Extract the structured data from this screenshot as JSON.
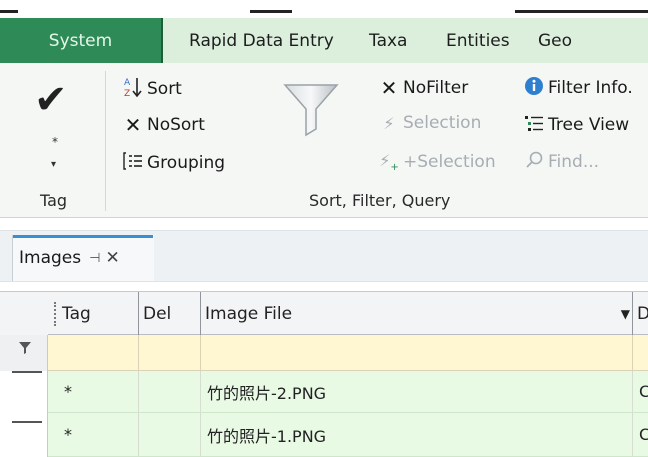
{
  "ribbon_tabs": {
    "system": "System",
    "rapid": "Rapid Data Entry",
    "taxa": "Taxa",
    "entities": "Entities",
    "geo": "Geo"
  },
  "tag_group": {
    "check_icon": "checkmark-icon",
    "star_text": "*",
    "label": "Tag"
  },
  "sort_group": {
    "sort_label": "Sort",
    "nosort_label": "NoSort",
    "grouping_label": "Grouping",
    "nofilter_label": "NoFilter",
    "selection_label": "Selection",
    "plus_selection_label": "+Selection",
    "filter_info_label": "Filter Info.",
    "tree_view_label": "Tree View",
    "find_label": "Find...",
    "group_label": "Sort, Filter, Query"
  },
  "doc_tab": {
    "title": "Images",
    "pin_glyph": "⊣",
    "close_glyph": "✕"
  },
  "grid": {
    "columns": [
      "Tag",
      "Del",
      "Image File",
      "D"
    ],
    "rows": [
      {
        "tag": "*",
        "del": "",
        "file": "竹的照片-2.PNG",
        "d": "C"
      },
      {
        "tag": "*",
        "del": "",
        "file": "竹的照片-1.PNG",
        "d": "C"
      }
    ]
  },
  "colors": {
    "accent_tab": "#2e8b57",
    "ribbon_tabs_bg": "#dcefdd",
    "filter_row": "#fff6d2",
    "data_row": "#e8f9e4",
    "doc_tab_indicator": "#3a8fd4"
  }
}
